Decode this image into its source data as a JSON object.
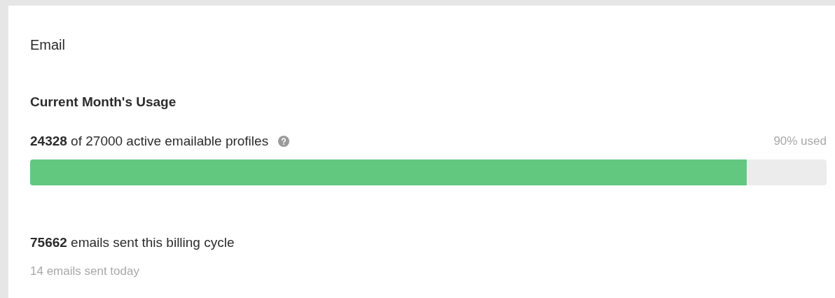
{
  "section_title": "Email",
  "usage": {
    "heading": "Current Month's Usage",
    "summary": "**24328** of 27000 active emailable profiles",
    "reading": "90% used",
    "level": 0.9
  },
  "emails": {
    "summary": "**75662** emails sent this billing cycle",
    "today": "14 emails sent today"
  }
}
